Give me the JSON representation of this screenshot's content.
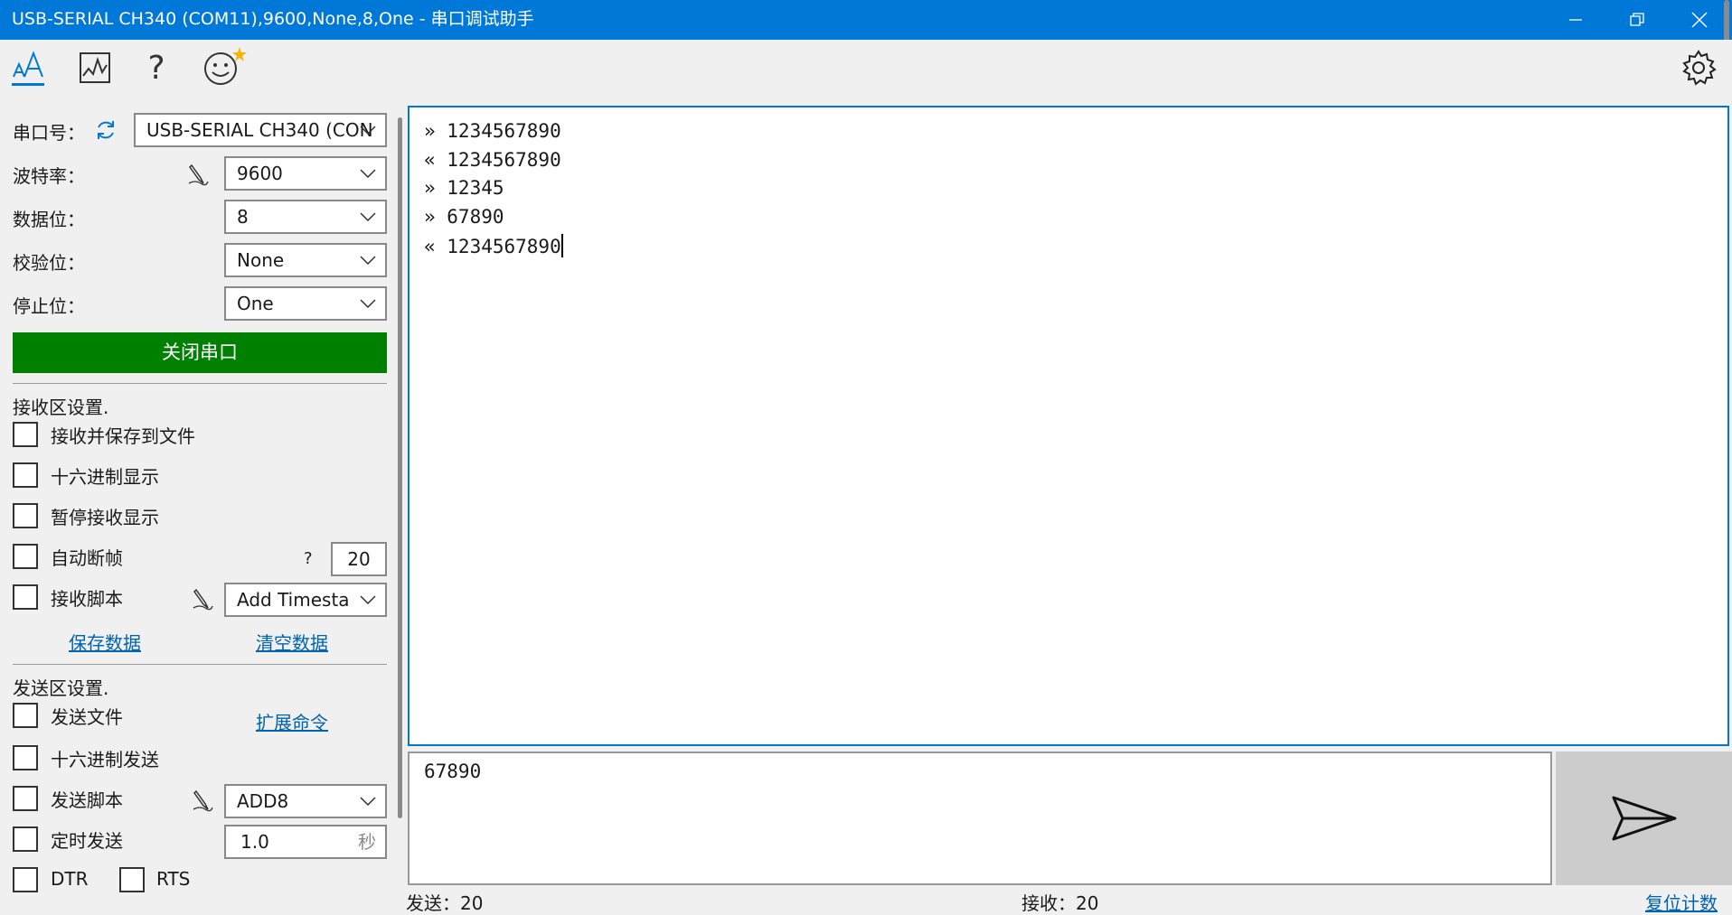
{
  "window": {
    "title": "USB-SERIAL CH340 (COM11),9600,None,8,One - 串口调试助手",
    "titlebar_color": "#0078d7"
  },
  "toolbar": {
    "icons": [
      "text-style-icon",
      "chart-icon",
      "help-icon",
      "smiley-icon",
      "gear-icon"
    ],
    "help_glyph": "?"
  },
  "serial": {
    "port_label": "串口号：",
    "port_value": "USB-SERIAL CH340 (CON",
    "baud_label": "波特率：",
    "baud_value": "9600",
    "databits_label": "数据位：",
    "databits_value": "8",
    "parity_label": "校验位：",
    "parity_value": "None",
    "stopbits_label": "停止位：",
    "stopbits_value": "One",
    "close_button": "关闭串口",
    "close_button_color": "#008000"
  },
  "receive_settings": {
    "title": "接收区设置.",
    "save_to_file": "接收并保存到文件",
    "hex_display": "十六进制显示",
    "pause_display": "暂停接收显示",
    "auto_frame": "自动断帧",
    "auto_frame_help": "?",
    "auto_frame_value": "20",
    "script": "接收脚本",
    "script_value": "Add Timesta",
    "save_data": "保存数据",
    "clear_data": "清空数据"
  },
  "send_settings": {
    "title": "发送区设置.",
    "send_file": "发送文件",
    "extend_cmd": "扩展命令",
    "hex_send": "十六进制发送",
    "script": "发送脚本",
    "script_value": "ADD8",
    "timed_send": "定时发送",
    "interval_value": "1.0",
    "interval_unit": "秒",
    "dtr": "DTR",
    "rts": "RTS"
  },
  "receive_area": {
    "lines": [
      "» 1234567890",
      "« 1234567890",
      "» 12345",
      "» 67890",
      "« 1234567890"
    ]
  },
  "send_area": {
    "text": "67890"
  },
  "status": {
    "sent": "发送：20",
    "received": "接收：20",
    "reset": "复位计数"
  }
}
